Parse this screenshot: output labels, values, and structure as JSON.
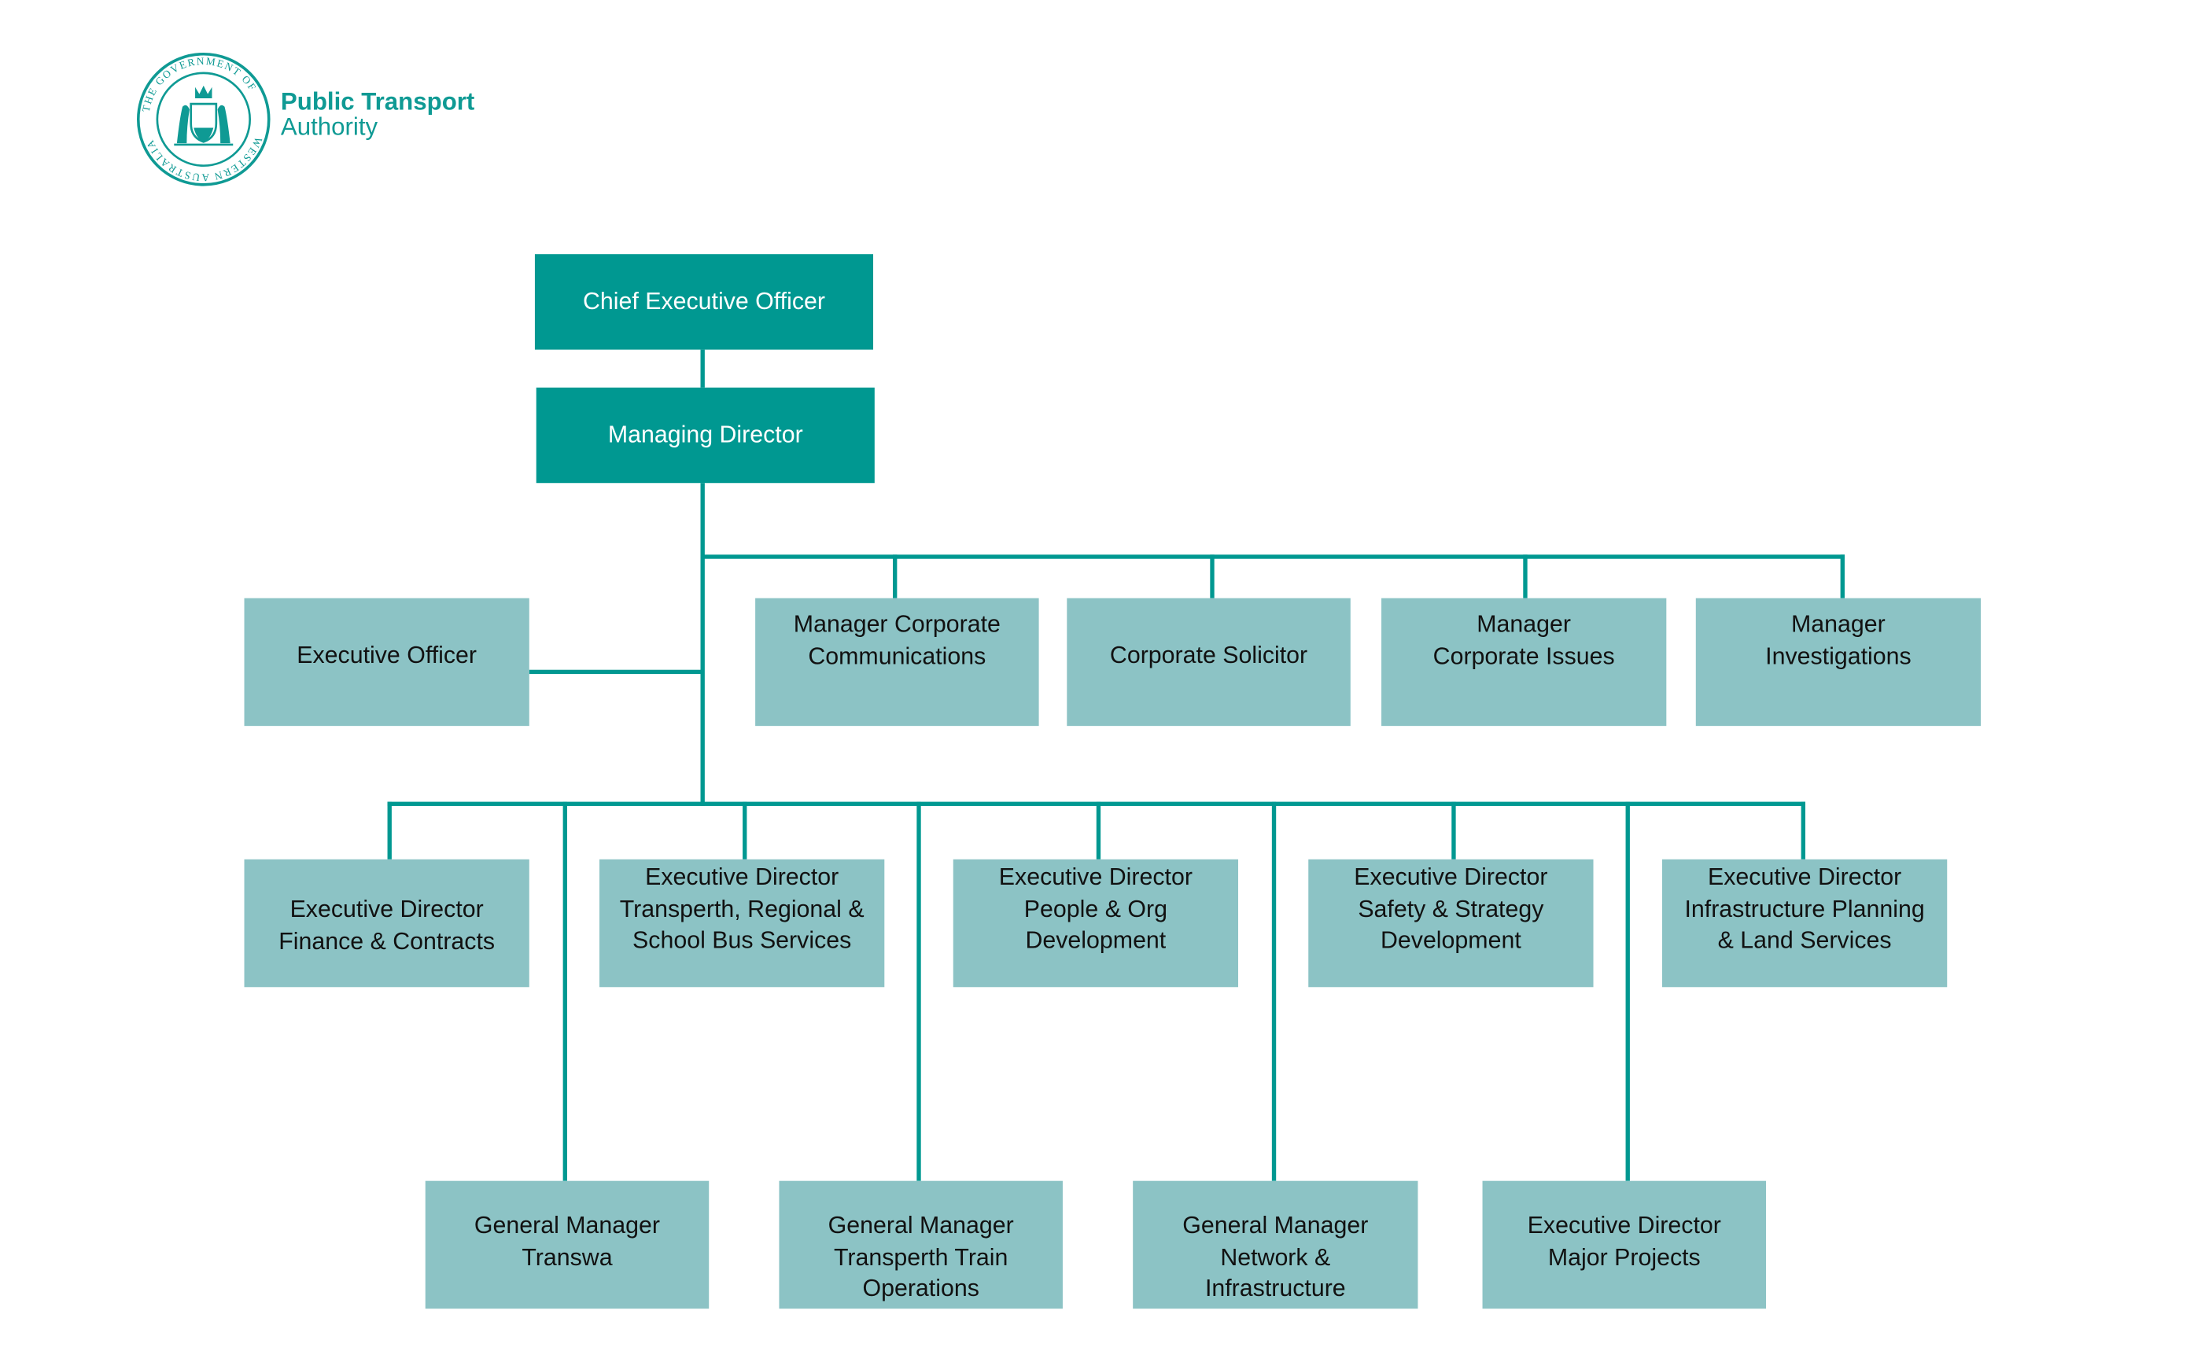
{
  "logo": {
    "seal_text": "THE GOVERNMENT OF WESTERN AUSTRALIA",
    "line1": "Public Transport",
    "line2": "Authority"
  },
  "colors": {
    "primary": "#009891",
    "secondary": "#8cc3c5",
    "lines": "#009891"
  },
  "chart": {
    "ceo": "Chief Executive Officer",
    "md": "Managing Director",
    "exec_officer": "Executive Officer",
    "direct_reports": [
      "Manager Corporate\nCommunications",
      "Corporate Solicitor",
      "Manager\nCorporate Issues",
      "Manager\nInvestigations"
    ],
    "executive_directors": [
      "Executive Director\nFinance & Contracts",
      "Executive Director\nTransperth, Regional &\nSchool Bus Services",
      "Executive Director\nPeople & Org\nDevelopment",
      "Executive Director\nSafety & Strategy\nDevelopment",
      "Executive Director\nInfrastructure Planning\n& Land Services"
    ],
    "lower_units": [
      "General Manager\nTranswa",
      "General Manager\nTransperth Train\nOperations",
      "General Manager\nNetwork &\nInfrastructure",
      "Executive Director\nMajor Projects"
    ]
  }
}
